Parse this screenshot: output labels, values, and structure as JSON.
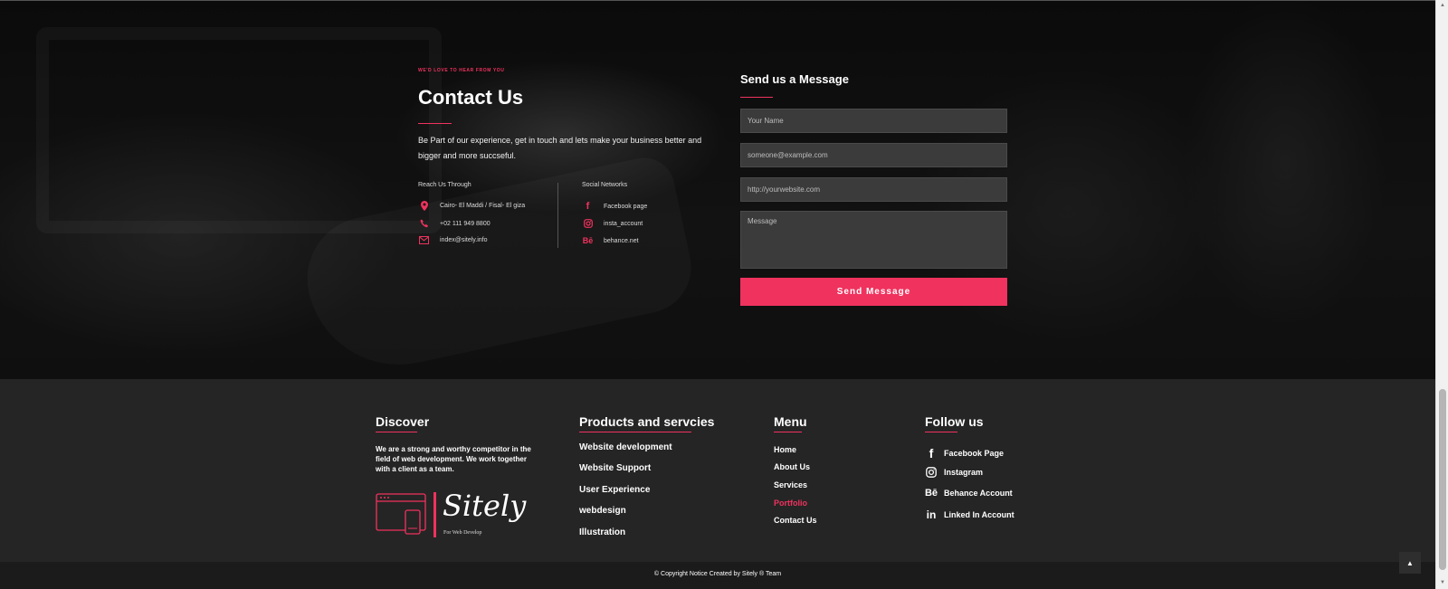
{
  "colors": {
    "accent": "#f0325e",
    "footer_bg": "#252525",
    "field_bg": "#3b3b3b"
  },
  "contact": {
    "eyebrow": "WE'D LOVE TO HEAR FROM YOU",
    "title": "Contact Us",
    "description": "Be Part of our experience, get in touch and lets make your business better and bigger and more succseful.",
    "reach_heading": "Reach Us Through",
    "reach_items": [
      {
        "icon": "map-marker-icon",
        "text": "Cairo- El Maddi / Fisal- El giza"
      },
      {
        "icon": "phone-icon",
        "text": "+02 111 949 8800"
      },
      {
        "icon": "envelope-icon",
        "text": "index@sitely.info"
      }
    ],
    "social_heading": "Social Networks",
    "social_items": [
      {
        "icon": "facebook-icon",
        "text": "Facebook page"
      },
      {
        "icon": "instagram-icon",
        "text": "insta_account"
      },
      {
        "icon": "behance-icon",
        "text": "behance.net"
      }
    ]
  },
  "form": {
    "title": "Send us a Message",
    "name_placeholder": "Your Name",
    "email_placeholder": "someone@example.com",
    "website_placeholder": "http://yourwebsite.com",
    "message_placeholder": "Message",
    "submit_label": "Send Message"
  },
  "footer": {
    "discover": {
      "heading": "Discover",
      "text": "We are a strong and worthy competitor in the field of web development. We work together with a client as a team.",
      "logo_text": "Sitely",
      "logo_tagline": "For Web Develop"
    },
    "products": {
      "heading": "Products and servcies",
      "items": [
        "Website development",
        "Website Support",
        "User Experience",
        "webdesign",
        "Illustration"
      ]
    },
    "menu": {
      "heading": "Menu",
      "items": [
        "Home",
        "About Us",
        "Services",
        "Portfolio",
        "Contact Us"
      ],
      "active": "Portfolio"
    },
    "follow": {
      "heading": "Follow us",
      "items": [
        {
          "icon": "facebook-icon",
          "text": "Facebook Page"
        },
        {
          "icon": "instagram-icon",
          "text": "Instagram"
        },
        {
          "icon": "behance-icon",
          "text": "Behance Account"
        },
        {
          "icon": "linkedin-icon",
          "text": "Linked In Account"
        }
      ]
    },
    "copyright": "© Copyright Notice Created by Sitely ® Team"
  }
}
